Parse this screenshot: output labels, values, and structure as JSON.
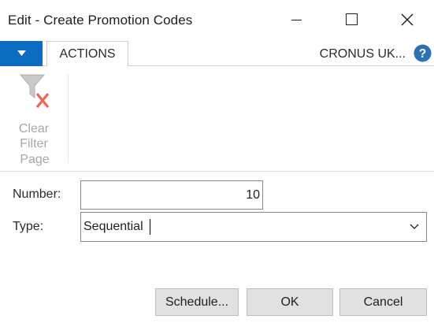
{
  "window": {
    "title": "Edit - Create Promotion Codes"
  },
  "ribbon": {
    "tab_actions": "ACTIONS",
    "company": "CRONUS UK...",
    "clear_filter_label": "Clear Filter",
    "group_label": "Page"
  },
  "form": {
    "number_label": "Number:",
    "number_value": "10",
    "type_label": "Type:",
    "type_value": "Sequential"
  },
  "buttons": {
    "schedule": "Schedule...",
    "ok": "OK",
    "cancel": "Cancel"
  },
  "colors": {
    "accent": "#0b6dc2",
    "disabled_text": "#a6a6a6",
    "filter_x": "#e8694f"
  },
  "icons": [
    "minimize-icon",
    "maximize-icon",
    "close-icon",
    "dropdown-arrow-icon",
    "help-icon",
    "clear-filter-icon",
    "chevron-down-icon"
  ]
}
